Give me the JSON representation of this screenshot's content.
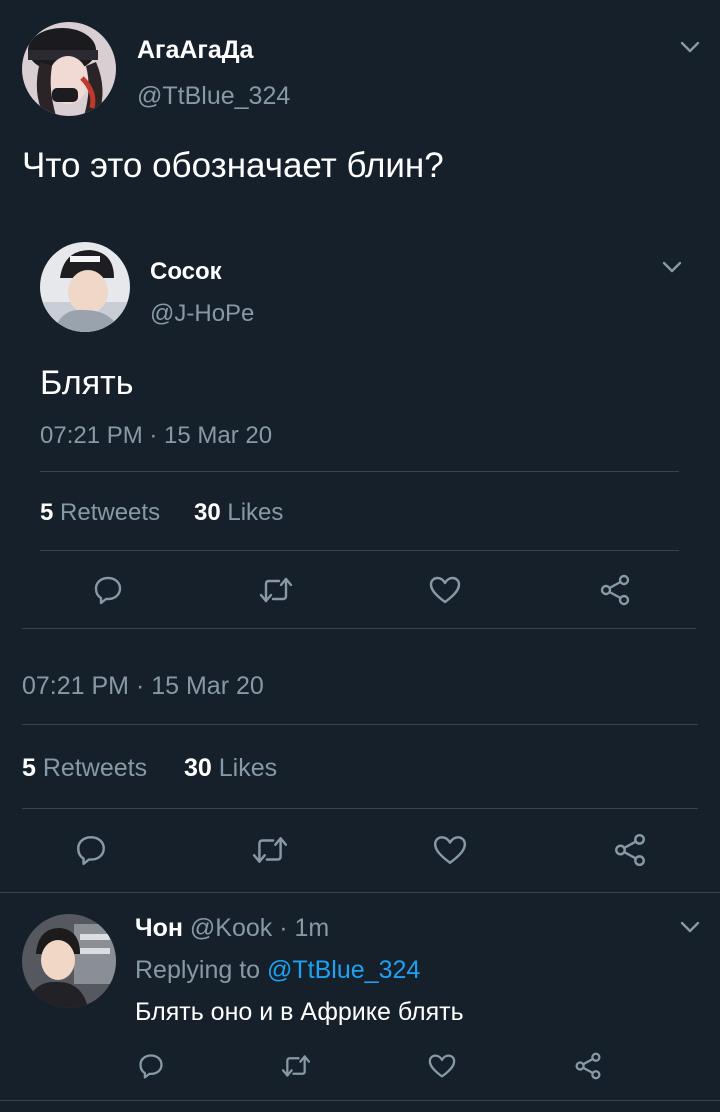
{
  "main_tweet": {
    "author_name": "АгаАгаДа",
    "author_handle": "@TtBlue_324",
    "text": "Что это обозначает блин?",
    "timestamp": "07:21 PM · 15 Mar 20",
    "retweets_count": "5",
    "retweets_label": "Retweets",
    "likes_count": "30",
    "likes_label": "Likes"
  },
  "quoted_tweet": {
    "author_name": "Сосок",
    "author_handle": "@J-HoPe",
    "text": "Блять",
    "timestamp": "07:21 PM · 15 Mar 20",
    "retweets_count": "5",
    "retweets_label": "Retweets",
    "likes_count": "30",
    "likes_label": "Likes"
  },
  "reply": {
    "author_name": "Чон",
    "author_handle": "@Kook",
    "separator": "·",
    "time_ago": "1m",
    "replying_prefix": "Replying to",
    "replying_to": "@TtBlue_324",
    "text": "Блять оно и в Африке блять"
  },
  "icons": {
    "reply": "speech-bubble-icon",
    "retweet": "retweet-icon",
    "like": "heart-icon",
    "share": "share-icon",
    "menu": "chevron-down-icon"
  },
  "colors": {
    "background": "#15202b",
    "secondary_text": "#8899a6",
    "link": "#1da1f2",
    "divider": "#38444d"
  }
}
